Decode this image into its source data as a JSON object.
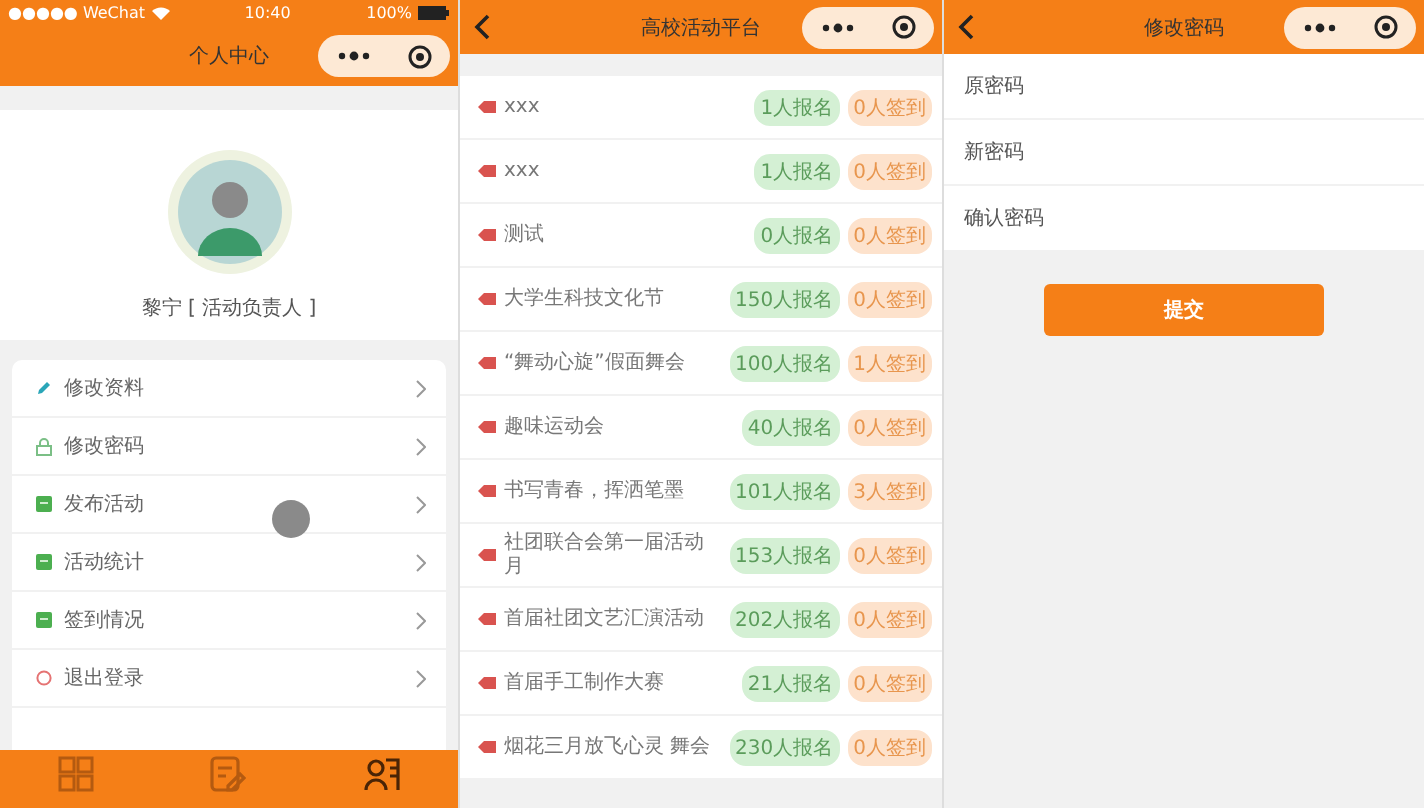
{
  "profile_screen": {
    "status_bar": {
      "carrier": "●●●●● WeChat",
      "time": "10:40",
      "battery": "100%"
    },
    "title": "个人中心",
    "user": {
      "name": "黎宁 [ 活动负责人 ]"
    },
    "menu": [
      {
        "kind": "edit",
        "label": "修改资料"
      },
      {
        "kind": "lock",
        "label": "修改密码"
      },
      {
        "kind": "doc",
        "label": "发布活动"
      },
      {
        "kind": "doc",
        "label": "活动统计"
      },
      {
        "kind": "doc",
        "label": "签到情况"
      },
      {
        "kind": "exit",
        "label": "退出登录"
      }
    ],
    "tab_bar": [
      {
        "kind": "grid",
        "selected": false
      },
      {
        "kind": "edit",
        "selected": false
      },
      {
        "kind": "user",
        "selected": true
      }
    ]
  },
  "activity_screen": {
    "title": "高校活动平台",
    "activities": [
      {
        "name": "xxx",
        "signups": "1人报名",
        "checkins": "0人签到"
      },
      {
        "name": "xxx",
        "signups": "1人报名",
        "checkins": "0人签到"
      },
      {
        "name": "测试",
        "signups": "0人报名",
        "checkins": "0人签到"
      },
      {
        "name": "大学生科技文化节",
        "signups": "150人报名",
        "checkins": "0人签到"
      },
      {
        "name": "“舞动心旋”假面舞会",
        "signups": "100人报名",
        "checkins": "1人签到"
      },
      {
        "name": "趣味运动会",
        "signups": "40人报名",
        "checkins": "0人签到"
      },
      {
        "name": "书写青春，挥洒笔墨",
        "signups": "101人报名",
        "checkins": "3人签到"
      },
      {
        "name": "社团联合会第一届活动月",
        "signups": "153人报名",
        "checkins": "0人签到"
      },
      {
        "name": "首届社团文艺汇演活动",
        "signups": "202人报名",
        "checkins": "0人签到"
      },
      {
        "name": "首届手工制作大赛",
        "signups": "21人报名",
        "checkins": "0人签到"
      },
      {
        "name": "烟花三月放飞心灵 舞会",
        "signups": "230人报名",
        "checkins": "0人签到"
      }
    ]
  },
  "password_screen": {
    "title": "修改密码",
    "fields": [
      {
        "placeholder": "原密码"
      },
      {
        "placeholder": "新密码"
      },
      {
        "placeholder": "确认密码"
      }
    ],
    "submit": "提交"
  }
}
